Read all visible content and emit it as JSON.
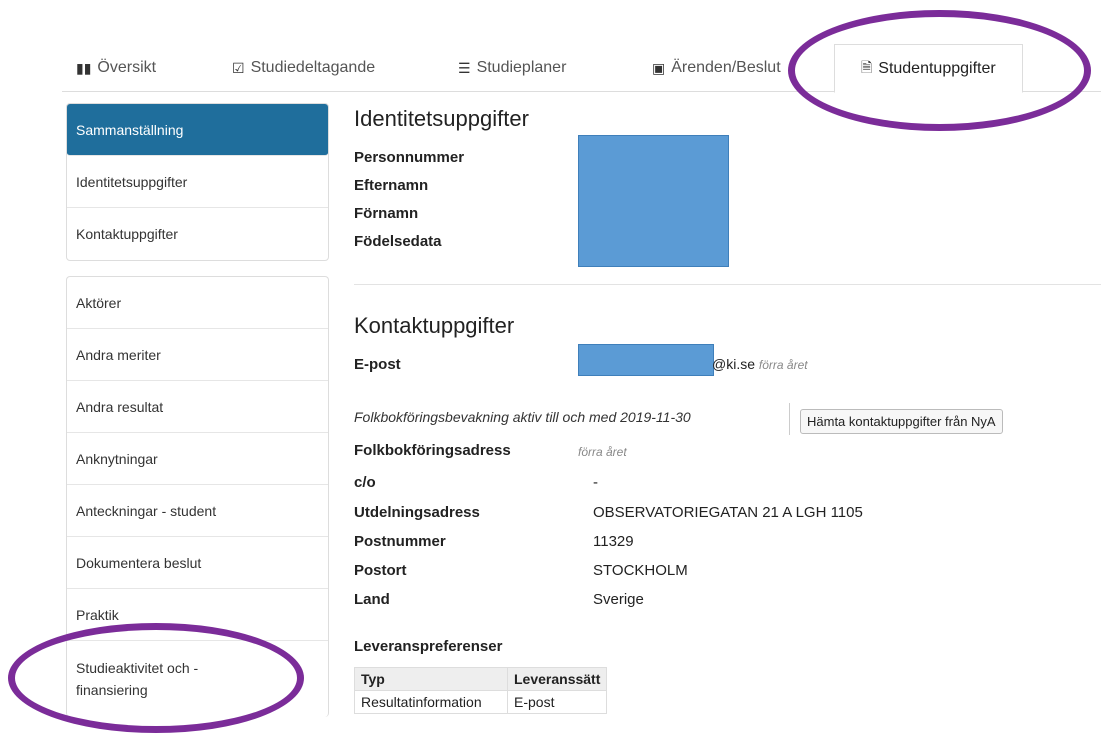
{
  "tabs": [
    {
      "label": "Översikt",
      "icon": "map-icon"
    },
    {
      "label": "Studiedeltagande",
      "icon": "check-square-icon"
    },
    {
      "label": "Studieplaner",
      "icon": "list-icon"
    },
    {
      "label": "Ärenden/Beslut",
      "icon": "inbox-icon"
    },
    {
      "label": "Studentuppgifter",
      "icon": "document-icon"
    }
  ],
  "sidebar": {
    "group1": [
      "Sammanställning",
      "Identitetsuppgifter",
      "Kontaktuppgifter"
    ],
    "group2": [
      "Aktörer",
      "Andra meriter",
      "Andra resultat",
      "Anknytningar",
      "Anteckningar - student",
      "Dokumentera beslut",
      "Praktik",
      "Studieaktivitet och -finansiering"
    ]
  },
  "identity": {
    "title": "Identitetsuppgifter",
    "labels": [
      "Personnummer",
      "Efternamn",
      "Förnamn",
      "Födelsedata"
    ]
  },
  "contact": {
    "title": "Kontaktuppgifter",
    "email_label": "E-post",
    "email_domain": "@ki.se",
    "email_note": "förra året",
    "bevakning": "Folkbokföringsbevakning aktiv till och med 2019-11-30",
    "fetch_button": "Hämta kontaktuppgifter från NyA",
    "address_label": "Folkbokföringsadress",
    "address_note": "förra året",
    "rows": [
      {
        "label": "c/o",
        "value": "-"
      },
      {
        "label": "Utdelningsadress",
        "value": "OBSERVATORIEGATAN 21 A LGH 1105"
      },
      {
        "label": "Postnummer",
        "value": "11329"
      },
      {
        "label": "Postort",
        "value": "STOCKHOLM"
      },
      {
        "label": "Land",
        "value": "Sverige"
      }
    ]
  },
  "delivery": {
    "title": "Leveranspreferenser",
    "headers": [
      "Typ",
      "Leveranssätt"
    ],
    "row": [
      "Resultatinformation",
      "E-post"
    ]
  },
  "colors": {
    "accent": "#1f6e9c",
    "highlight_circle": "#7b2c99",
    "redaction": "#5b9bd5"
  }
}
